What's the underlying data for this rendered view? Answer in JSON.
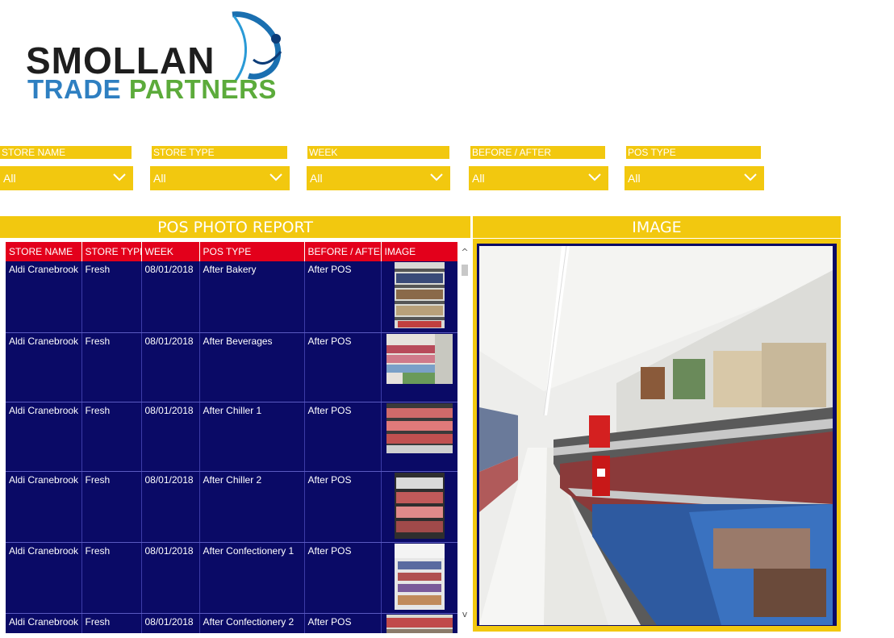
{
  "logo": {
    "top": "SMOLLAN",
    "trade": "TRADE",
    "partners": "PARTNERS"
  },
  "filters": [
    {
      "label": "STORE NAME",
      "value": "All"
    },
    {
      "label": "STORE TYPE",
      "value": "All"
    },
    {
      "label": "WEEK",
      "value": "All"
    },
    {
      "label": "BEFORE / AFTER",
      "value": "All"
    },
    {
      "label": "POS TYPE",
      "value": "All"
    }
  ],
  "report": {
    "title": "POS PHOTO REPORT",
    "columns": [
      "STORE NAME",
      "STORE TYPE",
      "WEEK",
      "POS TYPE",
      "BEFORE / AFTER",
      "IMAGE"
    ],
    "rows": [
      {
        "store": "Aldi Cranebrook",
        "type": "Fresh",
        "week": "08/01/2018",
        "pos": "After Bakery",
        "ba": "After POS"
      },
      {
        "store": "Aldi Cranebrook",
        "type": "Fresh",
        "week": "08/01/2018",
        "pos": "After Beverages",
        "ba": "After POS"
      },
      {
        "store": "Aldi Cranebrook",
        "type": "Fresh",
        "week": "08/01/2018",
        "pos": "After Chiller 1",
        "ba": "After POS"
      },
      {
        "store": "Aldi Cranebrook",
        "type": "Fresh",
        "week": "08/01/2018",
        "pos": "After Chiller 2",
        "ba": "After POS"
      },
      {
        "store": "Aldi Cranebrook",
        "type": "Fresh",
        "week": "08/01/2018",
        "pos": "After Confectionery 1",
        "ba": "After POS"
      },
      {
        "store": "Aldi Cranebrook",
        "type": "Fresh",
        "week": "08/01/2018",
        "pos": "After Confectionery 2",
        "ba": "After POS"
      }
    ],
    "scroll": {
      "up": "^",
      "down": "v"
    }
  },
  "image_panel": {
    "title": "IMAGE"
  },
  "colors": {
    "accent": "#f2c80f",
    "header_red": "#e3001b",
    "navy": "#0a0a66"
  }
}
